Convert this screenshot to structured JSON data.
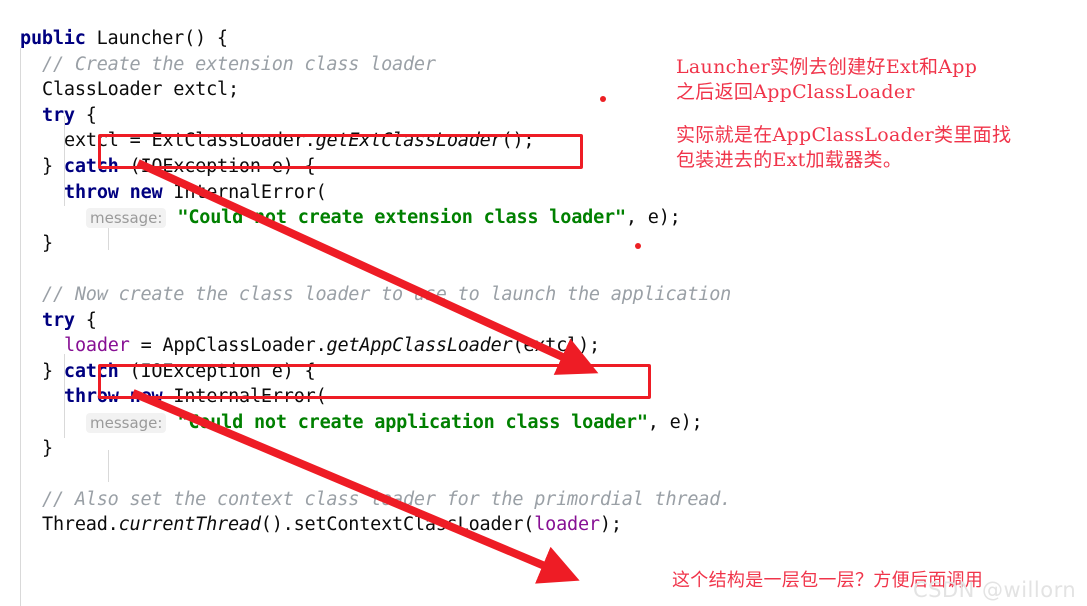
{
  "editor": {
    "language": "java",
    "background": "#ffffff",
    "colors": {
      "keyword": "#000080",
      "comment": "#9aa0a6",
      "string": "#008000",
      "field": "#871094",
      "text": "#0b0b0b",
      "hint_text": "#9a9a9a",
      "hint_background": "#f2f2f2",
      "indent_guide": "#d9d9d9",
      "annotation_red": "#ee1c25",
      "note_red": "#f0344a",
      "watermark": "#e3e3e3"
    },
    "lines": [
      {
        "n": 1,
        "indent": 0,
        "segments": [
          {
            "t": "public",
            "c": "kw"
          },
          {
            "t": " Launcher() {",
            "c": "plain"
          }
        ]
      },
      {
        "n": 2,
        "indent": 1,
        "segments": [
          {
            "t": "// Create the extension class loader",
            "c": "cmt"
          }
        ]
      },
      {
        "n": 3,
        "indent": 1,
        "segments": [
          {
            "t": "ClassLoader extcl;",
            "c": "plain"
          }
        ]
      },
      {
        "n": 4,
        "indent": 1,
        "segments": [
          {
            "t": "try",
            "c": "kw"
          },
          {
            "t": " {",
            "c": "plain"
          }
        ]
      },
      {
        "n": 5,
        "indent": 2,
        "segments": [
          {
            "t": "extcl = ExtClassLoader.",
            "c": "plain"
          },
          {
            "t": "getExtClassLoader",
            "c": "mth"
          },
          {
            "t": "();",
            "c": "plain"
          }
        ]
      },
      {
        "n": 6,
        "indent": 1,
        "segments": [
          {
            "t": "} ",
            "c": "plain"
          },
          {
            "t": "catch",
            "c": "kw"
          },
          {
            "t": " (IOException e) {",
            "c": "plain"
          }
        ]
      },
      {
        "n": 7,
        "indent": 2,
        "segments": [
          {
            "t": "throw",
            "c": "kw"
          },
          {
            "t": " ",
            "c": "plain"
          },
          {
            "t": "new",
            "c": "kw"
          },
          {
            "t": " InternalError(",
            "c": "plain"
          }
        ]
      },
      {
        "n": 8,
        "indent": 3,
        "segments": [
          {
            "t": "message:",
            "c": "hint"
          },
          {
            "t": " ",
            "c": "plain"
          },
          {
            "t": "\"Could not create extension class loader\"",
            "c": "str"
          },
          {
            "t": ", e);",
            "c": "plain"
          }
        ]
      },
      {
        "n": 9,
        "indent": 1,
        "segments": [
          {
            "t": "}",
            "c": "plain"
          }
        ]
      },
      {
        "n": 10,
        "indent": 1,
        "segments": [
          {
            "t": "",
            "c": "plain"
          }
        ]
      },
      {
        "n": 11,
        "indent": 1,
        "segments": [
          {
            "t": "// Now create the class loader to use to launch the application",
            "c": "cmt"
          }
        ]
      },
      {
        "n": 12,
        "indent": 1,
        "segments": [
          {
            "t": "try",
            "c": "kw"
          },
          {
            "t": " {",
            "c": "plain"
          }
        ]
      },
      {
        "n": 13,
        "indent": 2,
        "segments": [
          {
            "t": "loader",
            "c": "fld"
          },
          {
            "t": " = AppClassLoader.",
            "c": "plain"
          },
          {
            "t": "getAppClassLoader",
            "c": "mth"
          },
          {
            "t": "(extcl);",
            "c": "plain"
          }
        ]
      },
      {
        "n": 14,
        "indent": 1,
        "segments": [
          {
            "t": "} ",
            "c": "plain"
          },
          {
            "t": "catch",
            "c": "kw"
          },
          {
            "t": " (IOException e) {",
            "c": "plain"
          }
        ]
      },
      {
        "n": 15,
        "indent": 2,
        "segments": [
          {
            "t": "throw",
            "c": "kw"
          },
          {
            "t": " ",
            "c": "plain"
          },
          {
            "t": "new",
            "c": "kw"
          },
          {
            "t": " InternalError(",
            "c": "plain"
          }
        ]
      },
      {
        "n": 16,
        "indent": 3,
        "segments": [
          {
            "t": "message:",
            "c": "hint"
          },
          {
            "t": " ",
            "c": "plain"
          },
          {
            "t": "\"Could not create application class loader\"",
            "c": "str"
          },
          {
            "t": ", e);",
            "c": "plain"
          }
        ]
      },
      {
        "n": 17,
        "indent": 1,
        "segments": [
          {
            "t": "}",
            "c": "plain"
          }
        ]
      },
      {
        "n": 18,
        "indent": 1,
        "segments": [
          {
            "t": "",
            "c": "plain"
          }
        ]
      },
      {
        "n": 19,
        "indent": 1,
        "segments": [
          {
            "t": "// Also set the context class loader for the primordial thread.",
            "c": "cmt"
          }
        ]
      },
      {
        "n": 20,
        "indent": 1,
        "segments": [
          {
            "t": "Thread.",
            "c": "plain"
          },
          {
            "t": "currentThread",
            "c": "mth"
          },
          {
            "t": "().setContextClassLoader(",
            "c": "plain"
          },
          {
            "t": "loader",
            "c": "fld"
          },
          {
            "t": ");",
            "c": "plain"
          }
        ]
      }
    ]
  },
  "annotations": {
    "top_note_1": "Launcher实例去创建好Ext和App\n之后返回AppClassLoader",
    "top_note_2": "实际就是在AppClassLoader类里面找\n包装进去的Ext加载器类。",
    "bottom_note": "这个结构是一层包一层？方便后面调用"
  },
  "watermark": {
    "text": "CSDN @willorn"
  }
}
